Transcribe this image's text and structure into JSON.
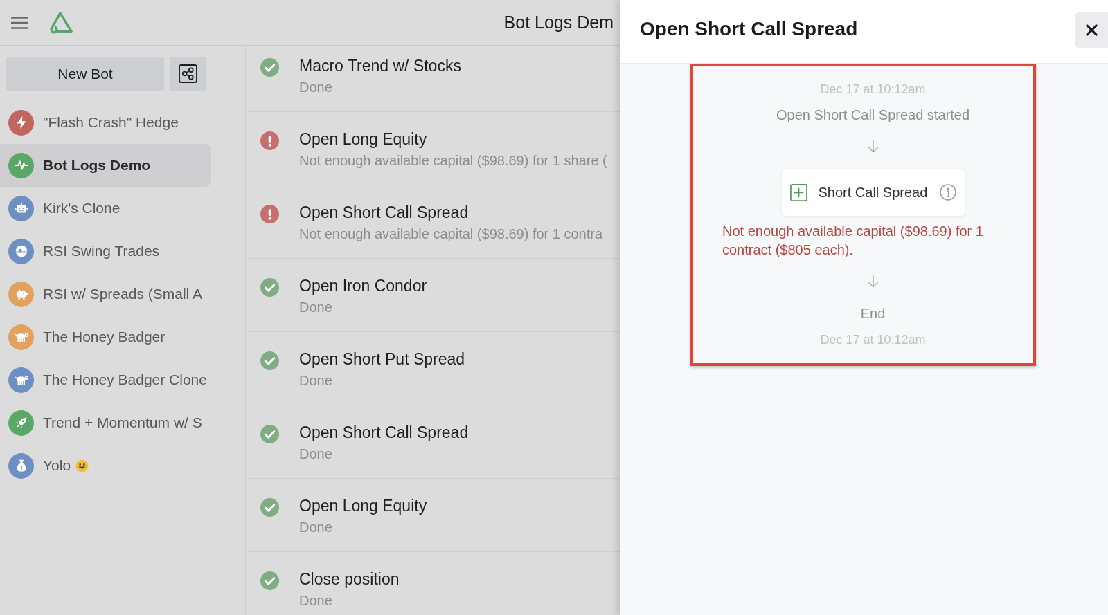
{
  "header": {
    "title": "Bot Logs Dem"
  },
  "sidebar": {
    "new_bot_label": "New Bot",
    "bots": [
      {
        "name": "\"Flash Crash\" Hedge",
        "color": "#c0665e",
        "selected": false
      },
      {
        "name": "Bot Logs Demo",
        "color": "#5aa866",
        "selected": true
      },
      {
        "name": "Kirk's Clone",
        "color": "#6d8fc4",
        "selected": false
      },
      {
        "name": "RSI Swing Trades",
        "color": "#6d8fc4",
        "selected": false
      },
      {
        "name": "RSI w/ Spreads (Small A",
        "color": "#e3a15e",
        "selected": false
      },
      {
        "name": "The Honey Badger",
        "color": "#e3a15e",
        "selected": false
      },
      {
        "name": "The Honey Badger Clone",
        "color": "#6d8fc4",
        "selected": false
      },
      {
        "name": "Trend + Momentum w/ S",
        "color": "#5aa866",
        "selected": false
      },
      {
        "name": "Yolo",
        "color": "#6d8fc4",
        "selected": false
      }
    ]
  },
  "log_entries": [
    {
      "kind": "done",
      "title": "Macro Trend w/ Stocks",
      "detail": "Done"
    },
    {
      "kind": "error",
      "title": "Open Long Equity",
      "detail": "Not enough available capital ($98.69) for 1 share ("
    },
    {
      "kind": "error",
      "title": "Open Short Call Spread",
      "detail": "Not enough available capital ($98.69) for 1 contra"
    },
    {
      "kind": "done",
      "title": "Open Iron Condor",
      "detail": "Done"
    },
    {
      "kind": "done",
      "title": "Open Short Put Spread",
      "detail": "Done"
    },
    {
      "kind": "done",
      "title": "Open Short Call Spread",
      "detail": "Done"
    },
    {
      "kind": "done",
      "title": "Open Long Equity",
      "detail": "Done"
    },
    {
      "kind": "done",
      "title": "Close position",
      "detail": "Done"
    }
  ],
  "drawer": {
    "title": "Open Short Call Spread",
    "timeline": [
      {
        "kind": "time",
        "text": "Dec 17 at 10:12am"
      },
      {
        "kind": "event",
        "text": "Open Short Call Spread started"
      },
      {
        "kind": "arrow"
      },
      {
        "kind": "step",
        "label": "Short Call Spread"
      },
      {
        "kind": "error",
        "text": "Not enough available capital ($98.69) for 1 contract ($805 each)."
      },
      {
        "kind": "arrow"
      },
      {
        "kind": "event",
        "text": "End"
      },
      {
        "kind": "time",
        "text": "Dec 17 at 10:12am"
      }
    ]
  }
}
